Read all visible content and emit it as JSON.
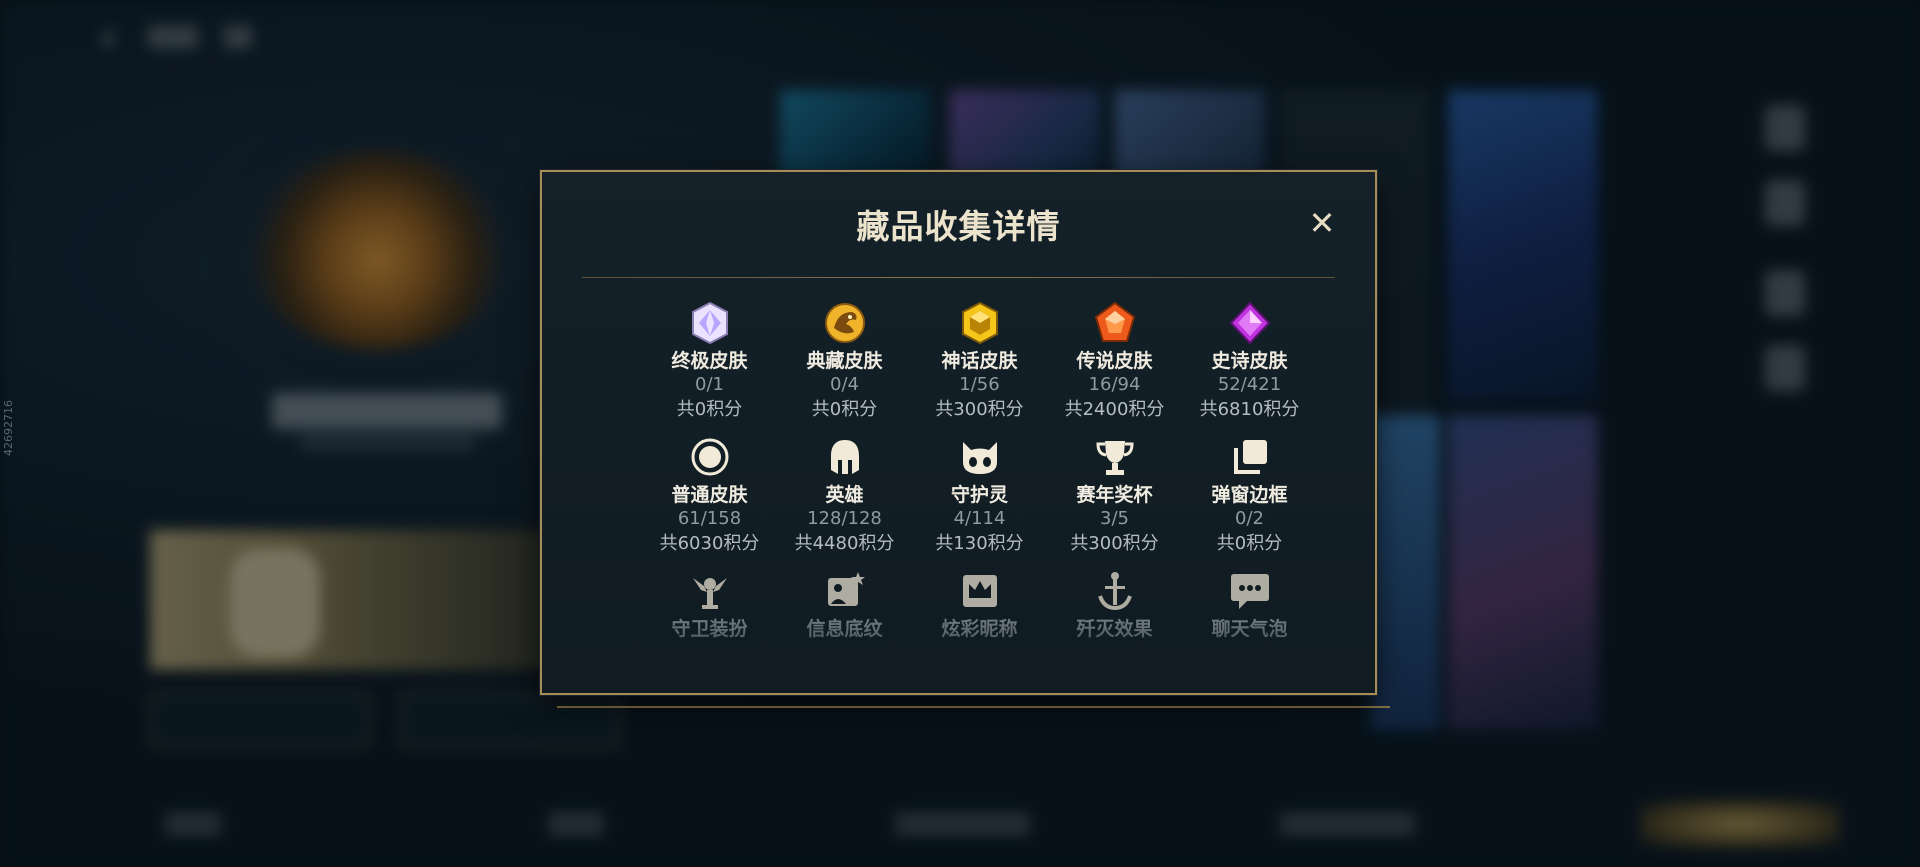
{
  "background": {
    "side_tag": "42692716"
  },
  "modal": {
    "title": "藏品收集详情",
    "close_label": "✕",
    "items": [
      {
        "icon": "ultimate-skin-icon",
        "name": "终极皮肤",
        "count": "0/1",
        "points": "共0积分"
      },
      {
        "icon": "prestige-skin-icon",
        "name": "典藏皮肤",
        "count": "0/4",
        "points": "共0积分"
      },
      {
        "icon": "mythic-skin-icon",
        "name": "神话皮肤",
        "count": "1/56",
        "points": "共300积分"
      },
      {
        "icon": "legendary-skin-icon",
        "name": "传说皮肤",
        "count": "16/94",
        "points": "共2400积分"
      },
      {
        "icon": "epic-skin-icon",
        "name": "史诗皮肤",
        "count": "52/421",
        "points": "共6810积分"
      },
      {
        "icon": "standard-skin-icon",
        "name": "普通皮肤",
        "count": "61/158",
        "points": "共6030积分"
      },
      {
        "icon": "champion-helmet-icon",
        "name": "英雄",
        "count": "128/128",
        "points": "共4480积分"
      },
      {
        "icon": "guardian-icon",
        "name": "守护灵",
        "count": "4/114",
        "points": "共130积分"
      },
      {
        "icon": "trophy-icon",
        "name": "赛年奖杯",
        "count": "3/5",
        "points": "共300积分"
      },
      {
        "icon": "popup-frame-icon",
        "name": "弹窗边框",
        "count": "0/2",
        "points": "共0积分"
      },
      {
        "icon": "ward-skin-icon",
        "name": "守卫装扮",
        "count": "",
        "points": ""
      },
      {
        "icon": "banner-pattern-icon",
        "name": "信息底纹",
        "count": "",
        "points": ""
      },
      {
        "icon": "nickname-crown-icon",
        "name": "炫彩昵称",
        "count": "",
        "points": ""
      },
      {
        "icon": "kill-effect-icon",
        "name": "歼灭效果",
        "count": "",
        "points": ""
      },
      {
        "icon": "chat-bubble-icon",
        "name": "聊天气泡",
        "count": "",
        "points": ""
      }
    ]
  },
  "colors": {
    "gold_border": "#a88c57",
    "title_text": "#ece3cd",
    "panel_bg": "#142128"
  }
}
